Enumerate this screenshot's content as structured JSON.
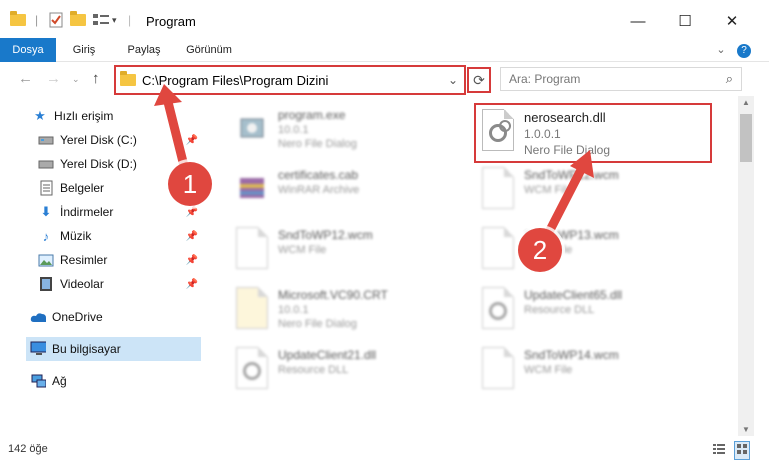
{
  "window": {
    "title": "Program"
  },
  "ribbon": {
    "tabs": [
      "Dosya",
      "Giriş",
      "Paylaş",
      "Görünüm"
    ]
  },
  "address": {
    "path": "C:\\Program Files\\Program Dizini",
    "search_placeholder": "Ara: Program"
  },
  "sidebar": {
    "items": [
      {
        "label": "Hızlı erişim",
        "icon": "star-icon"
      },
      {
        "label": "Yerel Disk (C:)",
        "icon": "drive-icon"
      },
      {
        "label": "Yerel Disk (D:)",
        "icon": "drive-icon"
      },
      {
        "label": "Belgeler",
        "icon": "documents-icon"
      },
      {
        "label": "İndirmeler",
        "icon": "download-icon"
      },
      {
        "label": "Müzik",
        "icon": "music-icon"
      },
      {
        "label": "Resimler",
        "icon": "pictures-icon"
      },
      {
        "label": "Videolar",
        "icon": "videos-icon"
      },
      {
        "label": "OneDrive",
        "icon": "cloud-icon"
      },
      {
        "label": "Bu bilgisayar",
        "icon": "computer-icon"
      },
      {
        "label": "Ağ",
        "icon": "network-icon"
      }
    ]
  },
  "files": [
    {
      "name": "program.exe",
      "line1": "10.0.1",
      "line2": "Nero File Dialog"
    },
    {
      "name": "nerosearch.dll",
      "line1": "1.0.0.1",
      "line2": "Nero File Dialog"
    },
    {
      "name": "certificates.cab",
      "line1": "WinRAR Archive",
      "line2": ""
    },
    {
      "name": "SndToWP12.wcm",
      "line1": "WCM File",
      "line2": ""
    },
    {
      "name": "SndToWP12.wcm",
      "line1": "WCM File",
      "line2": ""
    },
    {
      "name": "SndToWP13.wcm",
      "line1": "WCM File",
      "line2": ""
    },
    {
      "name": "Microsoft.VC90.CRT",
      "line1": "10.0.1",
      "line2": "Nero File Dialog"
    },
    {
      "name": "UpdateClient65.dll",
      "line1": "Resource DLL",
      "line2": ""
    },
    {
      "name": "UpdateClient21.dll",
      "line1": "Resource DLL",
      "line2": ""
    },
    {
      "name": "SndToWP14.wcm",
      "line1": "WCM File",
      "line2": ""
    }
  ],
  "status": {
    "count": "142 öğe"
  },
  "callouts": [
    "1",
    "2"
  ],
  "colors": {
    "accent": "#1979ca",
    "highlight": "#d63a3a",
    "badge": "#e0473f"
  }
}
